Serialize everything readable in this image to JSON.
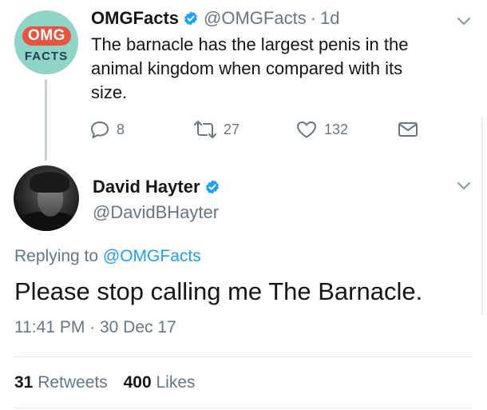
{
  "original_tweet": {
    "avatar": {
      "top_text": "OMG",
      "bottom_text": "FACTS"
    },
    "name": "OMGFacts",
    "handle": "@OMGFacts",
    "separator": "·",
    "time": "1d",
    "text": "The barnacle has the largest penis in the animal kingdom when compared with its size.",
    "actions": {
      "reply_count": "8",
      "retweet_count": "27",
      "like_count": "132"
    }
  },
  "reply_tweet": {
    "name": "David Hayter",
    "handle": "@DavidBHayter",
    "replying_prefix": "Replying to",
    "replying_to": "@OMGFacts",
    "text": "Please stop calling me The Barnacle.",
    "timestamp": "11:41 PM · 30 Dec 17",
    "retweets_count": "31",
    "retweets_label": "Retweets",
    "likes_count": "400",
    "likes_label": "Likes"
  },
  "colors": {
    "text": "#14171a",
    "secondary": "#657786",
    "accent": "#1da1f2",
    "divider": "#e1e8ed",
    "omg_red": "#e8543f",
    "omg_teal": "#8fd4c6"
  },
  "icons": [
    "verified-badge-icon",
    "chevron-down-icon",
    "reply-icon",
    "retweet-icon",
    "like-icon",
    "direct-message-icon"
  ]
}
